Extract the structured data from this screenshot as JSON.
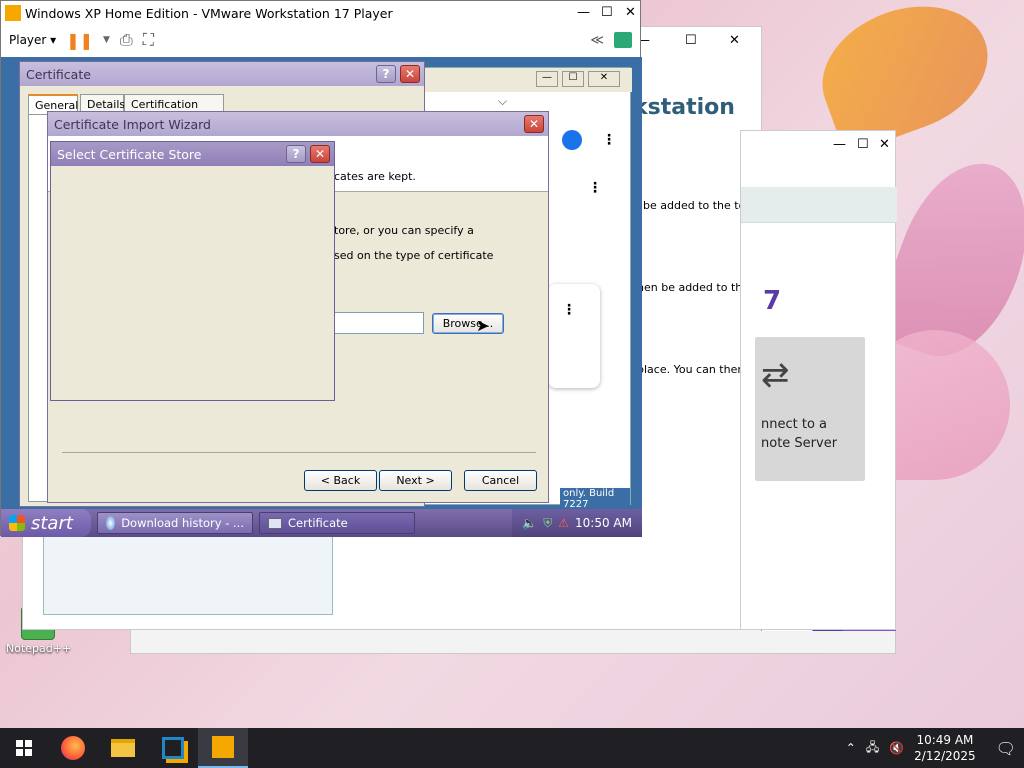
{
  "host": {
    "taskbar": {
      "clock_time": "10:49 AM",
      "clock_date": "2/12/2025"
    },
    "desktop_icons": [
      {
        "label": "Notepad++"
      }
    ]
  },
  "vmware": {
    "title": "Windows XP Home Edition - VMware Workstation 17 Player",
    "player_menu": "Player",
    "collapse_label": "≪"
  },
  "behind_browser": {
    "heading_fragment": "kstation",
    "lines": [
      "be added to the top",
      "hen be added to the",
      "place. You can then"
    ],
    "card_lines": [
      "nnect to a",
      "note Server"
    ],
    "version_fragment": "7",
    "footer_fragment": "only. Build 7227"
  },
  "xp": {
    "certificate": {
      "title": "Certificate",
      "tabs": [
        "General",
        "Details",
        "Certification Path"
      ]
    },
    "wizard": {
      "title": "Certificate Import Wizard",
      "line1": "cates are kept.",
      "line2": "tore, or you can specify a",
      "line3": "sed on the type of certificate",
      "browse_label": "Browse...",
      "back_label": "< Back",
      "next_label": "Next >",
      "cancel_label": "Cancel"
    },
    "store_dialog": {
      "title": "Select Certificate Store"
    },
    "taskbar": {
      "start_label": "start",
      "tasks": [
        {
          "label": "Download history - ..."
        },
        {
          "label": "Certificate"
        }
      ],
      "clock": "10:50 AM"
    }
  }
}
